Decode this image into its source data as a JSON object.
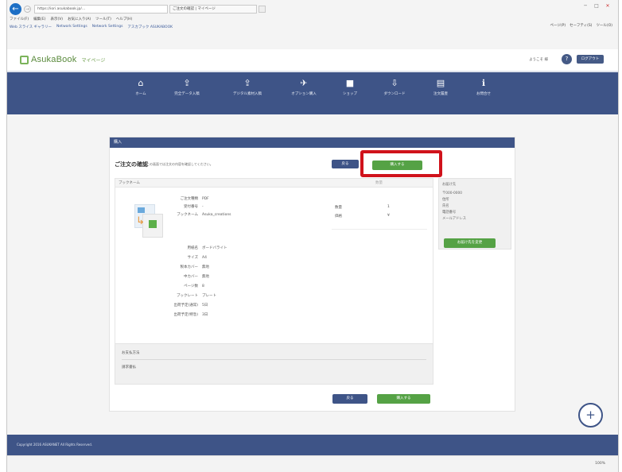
{
  "browser": {
    "url": "https://iori.asukabook.jp/...",
    "tab_title": "ご注文の確認 | マイページ",
    "menu": [
      "ファイル(F)",
      "編集(E)",
      "表示(V)",
      "お気に入り(A)",
      "ツール(T)",
      "ヘルプ(H)"
    ],
    "favorites": [
      "Web スライス ギャラリー",
      "Network Settings",
      "Network Settings",
      "アスカブック ASUKABOOK"
    ],
    "tools": [
      "ページ(P)",
      "セーフティ(S)",
      "ツール(O)"
    ],
    "zoom": "100%"
  },
  "site": {
    "logo": "AsukaBook",
    "logo_sub": "マイページ",
    "welcome": "ようこそ 様",
    "logout": "ログアウト"
  },
  "nav": [
    {
      "label": "ホーム",
      "icon": "home-icon",
      "glyph": "⌂"
    },
    {
      "label": "完全データ入稿",
      "icon": "upload-icon",
      "glyph": "⇪"
    },
    {
      "label": "デジタル素材入稿",
      "icon": "upload-icon",
      "glyph": "⇪"
    },
    {
      "label": "オプション購入",
      "icon": "plane-icon",
      "glyph": "✈"
    },
    {
      "label": "ショップ",
      "icon": "shop-icon",
      "glyph": "■"
    },
    {
      "label": "ダウンロード",
      "icon": "download-icon",
      "glyph": "⇩"
    },
    {
      "label": "注文履歴",
      "icon": "document-icon",
      "glyph": "▤"
    },
    {
      "label": "お問合せ",
      "icon": "info-icon",
      "glyph": "ℹ"
    }
  ],
  "card": {
    "header": "購入",
    "title": "ご注文の確認",
    "note": "この画面では注文の内容を確認してください。",
    "back_label": "戻る",
    "order_label": "購入する",
    "panel_head": "ブックネーム",
    "panel_head_right": "数量"
  },
  "order_details": [
    {
      "k": "ご注文種類",
      "v": "PDF"
    },
    {
      "k": "受付番号",
      "v": "-"
    },
    {
      "k": "ブックネーム",
      "v": "Asuka_creations"
    }
  ],
  "spec_details": [
    {
      "k": "用紙名",
      "v": "ボードバライト"
    },
    {
      "k": "サイズ",
      "v": "A4"
    },
    {
      "k": "製本カバー",
      "v": "無地"
    },
    {
      "k": "中カバー",
      "v": "無地"
    },
    {
      "k": "ページ数",
      "v": "8"
    },
    {
      "k": "ブックレート",
      "v": "プレート"
    },
    {
      "k": "出荷予定(通常)",
      "v": "5日"
    },
    {
      "k": "出荷予定(特急)",
      "v": "3日"
    }
  ],
  "qty": [
    {
      "k": "数量",
      "v": "1"
    },
    {
      "k": "価格",
      "v": "¥"
    }
  ],
  "shipping": {
    "title": "お届け先",
    "lines": [
      "〒000-0000",
      "住所",
      "氏名",
      "電話番号",
      "メールアドレス"
    ],
    "button": "お届け先を変更"
  },
  "payment": {
    "title": "お支払方法",
    "value": "請求書払"
  },
  "footer": "Copyright 2016 ASUKANET All Rights Reserved."
}
